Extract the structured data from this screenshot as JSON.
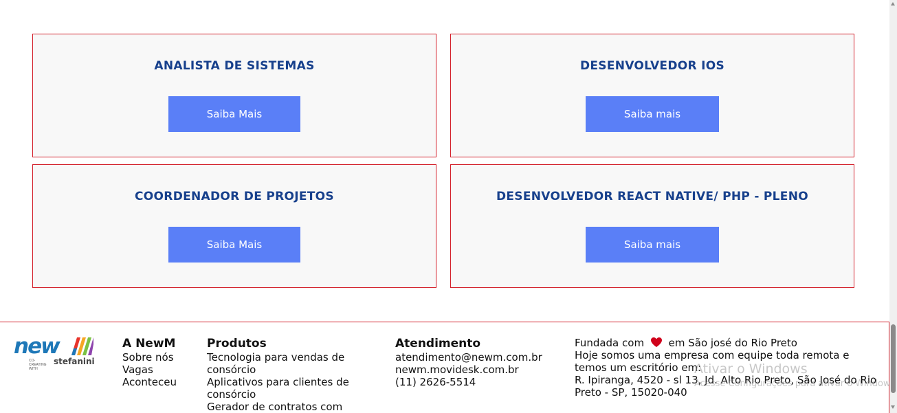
{
  "jobs": [
    {
      "title": "ANALISTA DE SISTEMAS",
      "button": "Saiba Mais"
    },
    {
      "title": "DESENVOLVEDOR IOS",
      "button": "Saiba mais"
    },
    {
      "title": "COORDENADOR DE PROJETOS",
      "button": "Saiba Mais"
    },
    {
      "title": "DESENVOLVEDOR REACT NATIVE/ PHP - PLENO",
      "button": "Saiba mais"
    }
  ],
  "footer": {
    "logo": {
      "word": "new",
      "tagline": "CO-CREATING WITH",
      "partner": "stefanini"
    },
    "newm": {
      "heading": "A NewM",
      "links": [
        "Sobre nós",
        "Vagas",
        "Aconteceu"
      ]
    },
    "produtos": {
      "heading": "Produtos",
      "items": [
        "Tecnologia para vendas de consórcio",
        "Aplicativos para clientes de consórcio",
        "Gerador de contratos com"
      ]
    },
    "atendimento": {
      "heading": "Atendimento",
      "items": [
        "atendimento@newm.com.br",
        "newm.movidesk.com.br",
        "(11) 2626-5514"
      ]
    },
    "about": {
      "founded_prefix": "Fundada com",
      "founded_suffix": "em São josé do Rio Preto",
      "description": "Hoje somos uma empresa com equipe toda remota e temos um escritório em:",
      "address": "R. Ipiranga, 4520 - sl 13, Jd. Alto Rio Preto, São José do Rio Preto - SP, 15020-040"
    }
  },
  "watermark": {
    "title": "Ativar o Windows",
    "subtitle": "Acesse Configurações para ativar o Windows."
  },
  "colors": {
    "accent": "#5a7ff7",
    "title": "#17408c",
    "border": "#d31f2a",
    "heart": "#d0021b"
  }
}
